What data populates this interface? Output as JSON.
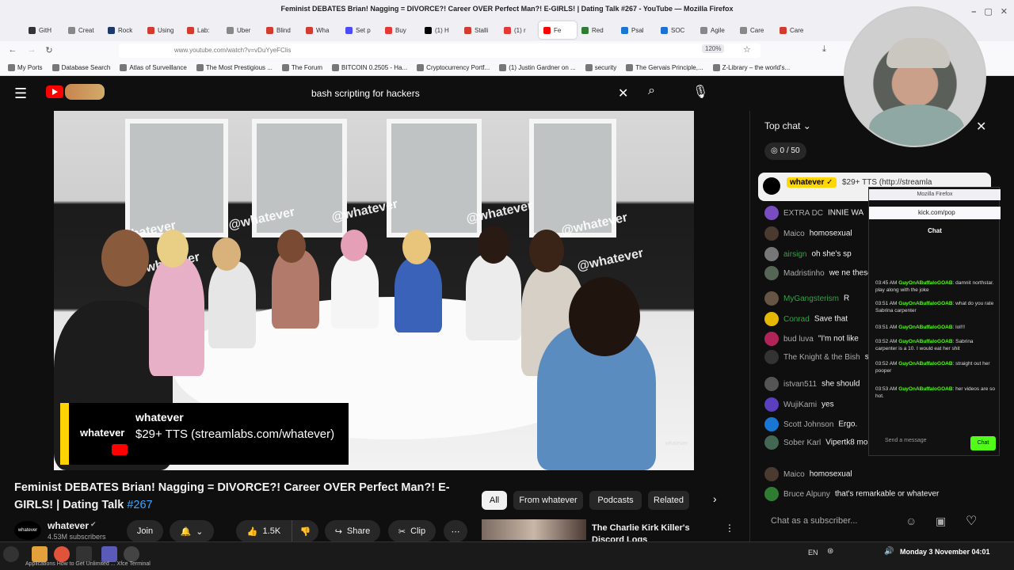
{
  "window": {
    "title": "Feminist DEBATES Brian! Nagging = DIVORCE?! Career OVER Perfect Man?! E-GIRLS! | Dating Talk #267 - YouTube — Mozilla Firefox"
  },
  "tabs": [
    {
      "label": "GitH",
      "color": "#333333"
    },
    {
      "label": "Creat",
      "color": "#888888"
    },
    {
      "label": "Rock",
      "color": "#1b3a6b"
    },
    {
      "label": "Using",
      "color": "#d43b2f"
    },
    {
      "label": "Lab:",
      "color": "#d43b2f"
    },
    {
      "label": "Uber",
      "color": "#888888"
    },
    {
      "label": "Blind",
      "color": "#d43b2f"
    },
    {
      "label": "Wha",
      "color": "#d43b2f"
    },
    {
      "label": "Set p",
      "color": "#4a4aff"
    },
    {
      "label": "Buy",
      "color": "#e53935"
    },
    {
      "label": "(1) H",
      "color": "#000000"
    },
    {
      "label": "Stalli",
      "color": "#d43b2f"
    },
    {
      "label": "(1) r",
      "color": "#e53935"
    },
    {
      "label": "Fe",
      "color": "#ff0000",
      "active": true
    },
    {
      "label": "Red",
      "color": "#2e7d32"
    },
    {
      "label": "Psal",
      "color": "#1976d2"
    },
    {
      "label": "SOC",
      "color": "#1e6fd9"
    },
    {
      "label": "Agile",
      "color": "#888888"
    },
    {
      "label": "Care",
      "color": "#888888"
    },
    {
      "label": "Care",
      "color": "#d43b2f"
    }
  ],
  "nav": {
    "url": "www.youtube.com/watch?v=vDuYyeFClis",
    "zoom": "120%"
  },
  "bookmarks": [
    "My Ports",
    "Database Search",
    "Atlas of Surveillance",
    "The Most Prestigious ...",
    "The Forum",
    "BITCOIN 0.2505 - Ha...",
    "Cryptocurrency Portf...",
    "(1) Justin Gardner on ...",
    "security",
    "The Gervais Principle,...",
    "Z-Library – the world's..."
  ],
  "youtube": {
    "search_query": "bash scripting for hackers",
    "video": {
      "watermark_text": "@whatever",
      "overlay": {
        "logo": "whatever",
        "name": "whatever",
        "message": "$29+ TTS (streamlabs.com/whatever)"
      },
      "corner_mark": "whatever"
    },
    "title_main": "Feminist DEBATES Brian! Nagging = DIVORCE?! Career OVER Perfect Man?! E-GIRLS! | Dating Talk ",
    "title_hash": "#267",
    "channel": {
      "avatar_text": "whatever",
      "name": "whatever",
      "subscribers": "4.53M subscribers"
    },
    "actions": {
      "join": "Join",
      "likes": "1.5K",
      "share": "Share",
      "clip": "Clip"
    },
    "chips": [
      "All",
      "From whatever",
      "Podcasts",
      "Related"
    ],
    "related": {
      "title": "The Charlie Kirk Killer's Discord Logs"
    }
  },
  "chat": {
    "header": "Top chat",
    "points": "0 / 50",
    "pinned": {
      "name": "whatever ✓",
      "message": "$29+ TTS (http://streamla"
    },
    "messages": [
      {
        "name": "EXTRA DC",
        "text": "INNIE WA",
        "color": "#7a4cc2"
      },
      {
        "name": "Maico",
        "text": "homosexual",
        "color": "#4a3a30"
      },
      {
        "name": "airsign",
        "text": "oh she's sp",
        "color": "#777777",
        "member": true
      },
      {
        "name": "Madristinho",
        "text": "we ne these women to stop",
        "color": "#556655"
      },
      {
        "name": "MyGangsterism",
        "text": "R",
        "color": "#665544",
        "member": true
      },
      {
        "name": "Conrad",
        "text": "Save that",
        "color": "#e6b800",
        "member": true
      },
      {
        "name": "bud luva",
        "text": "\"I'm not like",
        "color": "#b0245a"
      },
      {
        "name": "The Knight & the Bish",
        "text": "signaling",
        "color": "#333333"
      },
      {
        "name": "istvan511",
        "text": "she should",
        "color": "#555555"
      },
      {
        "name": "WujiKami",
        "text": "yes",
        "color": "#5a3fbf"
      },
      {
        "name": "Scott Johnson",
        "text": "Ergo.",
        "color": "#1976d2"
      },
      {
        "name": "Sober Karl",
        "text": "Vipertk8 money and resources",
        "color": "#446655"
      },
      {
        "name": "Maico",
        "text": "homosexual",
        "color": "#4a3a30"
      },
      {
        "name": "Bruce Alpuny",
        "text": "that's remarkable or whatever",
        "color": "#2e7d32"
      }
    ],
    "input_placeholder": "Chat as a subscriber..."
  },
  "kick_popup": {
    "window_title": "Mozilla Firefox",
    "url": "kick.com/pop",
    "header": "Chat",
    "lines": [
      {
        "time": "03:45 AM",
        "name": "GuyOnABuffaloGOAB",
        "text": ": damnit northstar. play along with the joke"
      },
      {
        "time": "03:51 AM",
        "name": "GuyOnABuffaloGOAB",
        "text": ": what do you rate Sabrina carpenter"
      },
      {
        "time": "03:51 AM",
        "name": "GuyOnABuffaloGOAB",
        "text": ": lol!!!"
      },
      {
        "time": "03:52 AM",
        "name": "GuyOnABuffaloGOAB",
        "text": ": Sabrina carpenter is a 10. I would eat her shit"
      },
      {
        "time": "03:52 AM",
        "name": "GuyOnABuffaloGOAB",
        "text": ": straight out her pooper"
      },
      {
        "time": "03:53 AM",
        "name": "GuyOnABuffaloGOAB",
        "text": ": her videos are so hot."
      }
    ],
    "send_placeholder": "Send a message",
    "send_button": "Chat"
  },
  "taskbar": {
    "lang": "EN",
    "clock": "Monday  3 November 04:01",
    "labels": "Applications   How to Get Unlimited ...   Xfce Terminal"
  }
}
